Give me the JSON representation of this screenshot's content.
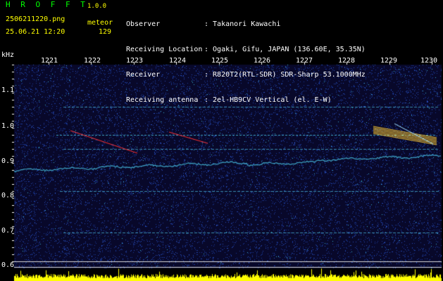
{
  "header": {
    "logo": "H R O F F T",
    "version": "1.0.0",
    "filename": "2506211220.png",
    "timestamp": "25.06.21 12:20",
    "meteor_label": "meteor",
    "meteor_count": "129",
    "info": [
      {
        "label": "Observer",
        "value": ": Takanori Kawachi"
      },
      {
        "label": "Receiving Location",
        "value": ": Ogaki, Gifu, JAPAN (136.60E, 35.35N)"
      },
      {
        "label": "Receiver",
        "value": ": R820T2(RTL-SDR) SDR-Sharp 53.1000MHz"
      },
      {
        "label": "Receiving antenna",
        "value": ": 2el-HB9CV Vertical (el. E-W)"
      }
    ]
  },
  "axis": {
    "y_unit": "kHz",
    "y_ticks": [
      "1.1",
      "1.0",
      "0.9",
      "0.8",
      "0.7",
      "0.6"
    ],
    "x_ticks": [
      "1221",
      "1222",
      "1223",
      "1224",
      "1225",
      "1226",
      "1227",
      "1228",
      "1229",
      "1230"
    ]
  },
  "colors": {
    "background": "#08082a",
    "noise": "#1a3a9a",
    "tone": "#3fa7c9",
    "meteor": "#ff3030",
    "audio_bar": "#ffff00",
    "logo": "#00ff00"
  }
}
